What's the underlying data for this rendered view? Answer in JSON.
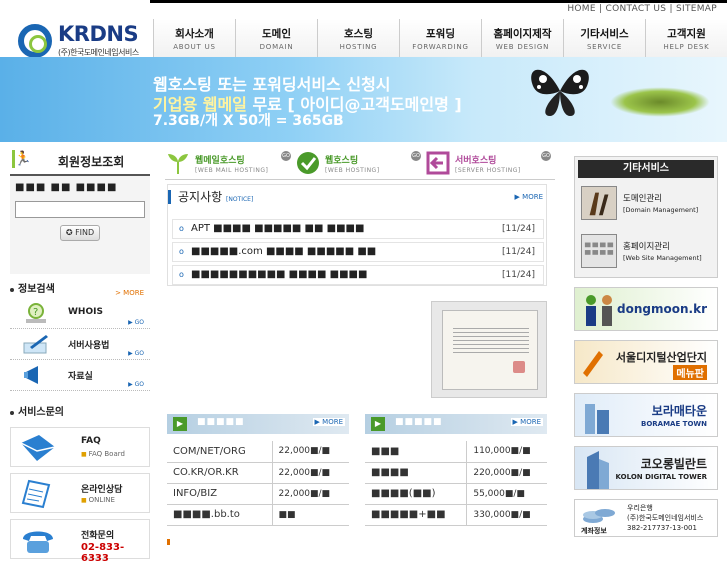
{
  "top_links": [
    "HOME",
    "CONTACT US",
    "SITEMAP"
  ],
  "logo": {
    "name": "KRDNS",
    "sub": "(주)한국도메인네임서비스"
  },
  "nav": [
    {
      "ko": "회사소개",
      "en": "ABOUT US"
    },
    {
      "ko": "도메인",
      "en": "DOMAIN"
    },
    {
      "ko": "호스팅",
      "en": "HOSTING"
    },
    {
      "ko": "포워딩",
      "en": "FORWARDING"
    },
    {
      "ko": "홈페이지제작",
      "en": "WEB DESIGN"
    },
    {
      "ko": "기타서비스",
      "en": "SERVICE"
    },
    {
      "ko": "고객지원",
      "en": "HELP DESK"
    }
  ],
  "banner": {
    "line1": "웹호스팅 또는 포워딩서비스 신청시",
    "line2a": "기업용 웹메일",
    "line2b": " 무료 [ 아이디@고객도메인명 ]",
    "line3": "7.3GB/개 X 50개 = 365GB"
  },
  "member": {
    "title": "회원정보조회",
    "label": "■■■ ■■ ■■■■",
    "find": "FIND"
  },
  "info_search": {
    "title": "정보검색",
    "more": "> MORE",
    "items": [
      {
        "label": "WHOIS",
        "go": "GO"
      },
      {
        "label": "서버사용법",
        "go": "GO"
      },
      {
        "label": "자료실",
        "go": "GO"
      }
    ]
  },
  "service_inquiry": {
    "title": "서비스문의",
    "faq": {
      "t1": "FAQ",
      "t2": "FAQ Board"
    },
    "online": {
      "t1": "온라인상담",
      "t2": "ONLINE"
    },
    "phone": {
      "t1": "전화문의",
      "number": "02-833-6333"
    }
  },
  "service_tabs": [
    {
      "name": "웹메일호스팅",
      "en": "[WEB MAIL HOSTING]",
      "go": "GO",
      "color": "#8cc63f"
    },
    {
      "name": "웹호스팅",
      "en": "[WEB HOSTING]",
      "go": "GO",
      "color": "#4a9a2a"
    },
    {
      "name": "서버호스팅",
      "en": "[SERVER HOSTING]",
      "go": "GO",
      "color": "#b04a9a"
    }
  ],
  "notice": {
    "title": "공지사항",
    "title_en": "[NOTICE]",
    "more": "MORE",
    "items": [
      {
        "text": "APT ■■■■ ■■■■■ ■■ ■■■■",
        "date": "[11/24]"
      },
      {
        "text": "■■■■■.com ■■■■ ■■■■■ ■■",
        "date": "[11/24]"
      },
      {
        "text": "■■■■■■■■■■ ■■■■ ■■■■",
        "date": "[11/24]"
      }
    ]
  },
  "price_left": {
    "head": "■■■■■",
    "more": "MORE",
    "rows": [
      {
        "name": "COM/NET/ORG",
        "price": "22,000■/■"
      },
      {
        "name": "CO.KR/OR.KR",
        "price": "22,000■/■"
      },
      {
        "name": "INFO/BIZ",
        "price": "22,000■/■"
      },
      {
        "name": "■■■■.bb.to",
        "price": "■■"
      }
    ]
  },
  "price_right": {
    "head": "■■■■■",
    "more": "MORE",
    "rows": [
      {
        "name": "■■■",
        "price": "110,000■/■"
      },
      {
        "name": "■■■■",
        "price": "220,000■/■"
      },
      {
        "name": "■■■■(■■)",
        "price": "55,000■/■"
      },
      {
        "name": "■■■■■+■■",
        "price": "330,000■/■"
      }
    ]
  },
  "etc_services": {
    "title": "기타서비스",
    "items": [
      {
        "ko": "도메인관리",
        "en": "[Domain Management]"
      },
      {
        "ko": "홈페이지관리",
        "en": "[Web Site Management]"
      }
    ]
  },
  "ads": [
    {
      "text": "dongmoon.kr",
      "sub": "",
      "color": "#1a3c85"
    },
    {
      "text": "서울디지털산업단지",
      "sub": "메뉴판",
      "color": "#222"
    },
    {
      "text": "보라매타운",
      "sub": "BORAMAE TOWN",
      "color": "#1a3c85"
    },
    {
      "text": "코오롱빌란트",
      "sub": "KOLON DIGITAL TOWER",
      "color": "#222"
    }
  ],
  "bank": {
    "label": "계좌정보",
    "lines": [
      "우리은행",
      "(주)한국도메인네임서비스",
      "382-217737-13-001"
    ]
  }
}
